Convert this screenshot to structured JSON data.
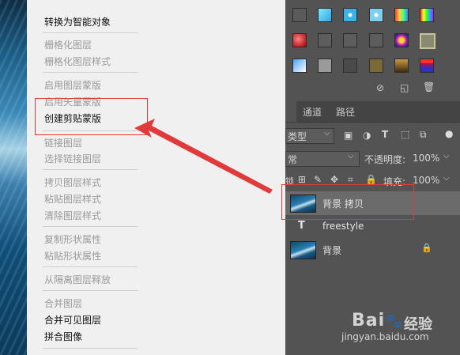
{
  "menu": {
    "items": [
      {
        "label": "转换为智能对象",
        "enabled": true
      },
      {
        "label": "栅格化图层",
        "enabled": false
      },
      {
        "label": "栅格化图层样式",
        "enabled": false
      },
      {
        "label": "启用图层蒙版",
        "enabled": false
      },
      {
        "label": "启用矢量蒙版",
        "enabled": false
      },
      {
        "label": "创建剪贴蒙版",
        "enabled": true
      },
      {
        "label": "链接图层",
        "enabled": false
      },
      {
        "label": "选择链接图层",
        "enabled": false
      },
      {
        "label": "拷贝图层样式",
        "enabled": false
      },
      {
        "label": "粘贴图层样式",
        "enabled": false
      },
      {
        "label": "清除图层样式",
        "enabled": false
      },
      {
        "label": "复制形状属性",
        "enabled": false
      },
      {
        "label": "粘贴形状属性",
        "enabled": false
      },
      {
        "label": "从隔离图层释放",
        "enabled": false
      },
      {
        "label": "合并图层",
        "enabled": false
      },
      {
        "label": "合并可见图层",
        "enabled": true
      },
      {
        "label": "拼合图像",
        "enabled": true
      }
    ]
  },
  "panel": {
    "tabs": [
      "通道",
      "路径"
    ],
    "filter_kind": "类型",
    "blend_mode": "常",
    "opacity_label": "不透明度:",
    "opacity_value": "100%",
    "lock_label": "锁",
    "fill_label": "填充:",
    "fill_value": "100%",
    "layers": [
      {
        "name": "背景 拷贝",
        "type": "image",
        "selected": true
      },
      {
        "name": "freestyle",
        "type": "text",
        "selected": false
      },
      {
        "name": "背景",
        "type": "image",
        "selected": false,
        "locked": true
      }
    ]
  },
  "watermark": {
    "brand": "Bai",
    "brand2": "经验",
    "url": "jingyan.baidu.com"
  },
  "colors": {
    "annotation": "#e13a3a",
    "menu_bg": "#f0f0f0",
    "panel_bg": "#535353"
  }
}
